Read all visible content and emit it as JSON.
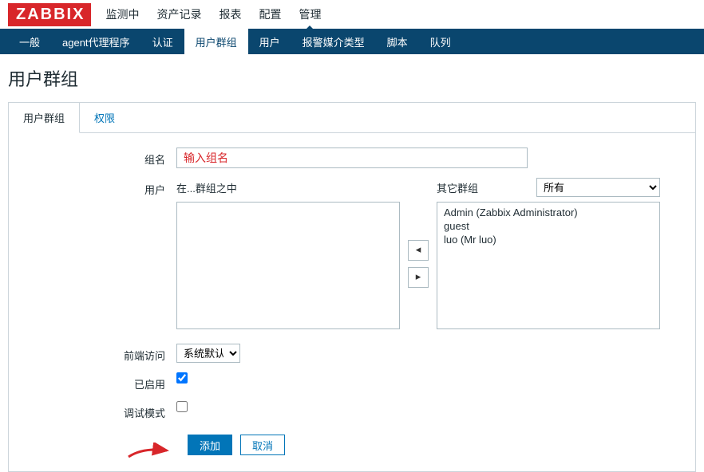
{
  "logo": "ZABBIX",
  "topnav": {
    "items": [
      {
        "label": "监测中"
      },
      {
        "label": "资产记录"
      },
      {
        "label": "报表"
      },
      {
        "label": "配置"
      },
      {
        "label": "管理",
        "active": true
      }
    ]
  },
  "subnav": {
    "items": [
      {
        "label": "一般"
      },
      {
        "label": "agent代理程序"
      },
      {
        "label": "认证"
      },
      {
        "label": "用户群组",
        "active": true
      },
      {
        "label": "用户"
      },
      {
        "label": "报警媒介类型"
      },
      {
        "label": "脚本"
      },
      {
        "label": "队列"
      }
    ]
  },
  "page_title": "用户群组",
  "tabs": [
    {
      "label": "用户群组",
      "active": true
    },
    {
      "label": "权限",
      "active": false
    }
  ],
  "form": {
    "group_name_label": "组名",
    "group_name_value": "输入组名",
    "users_label": "用户",
    "in_group_label": "在...群组之中",
    "other_group_label": "其它群组",
    "other_group_selected": "所有",
    "other_group_options": [
      "所有"
    ],
    "left_list": [],
    "right_list": [
      "Admin (Zabbix Administrator)",
      "guest",
      "luo (Mr luo)"
    ],
    "mover_left_label": "◂",
    "mover_right_label": "▸",
    "frontend_access_label": "前端访问",
    "frontend_access_value": "系统默认",
    "frontend_access_options": [
      "系统默认"
    ],
    "enabled_label": "已启用",
    "enabled_checked": true,
    "debug_label": "调试模式",
    "debug_checked": false
  },
  "actions": {
    "add_label": "添加",
    "cancel_label": "取消"
  },
  "colors": {
    "brand_red": "#d8262a",
    "nav_bg": "#0a466e",
    "link_blue": "#0275b8"
  }
}
